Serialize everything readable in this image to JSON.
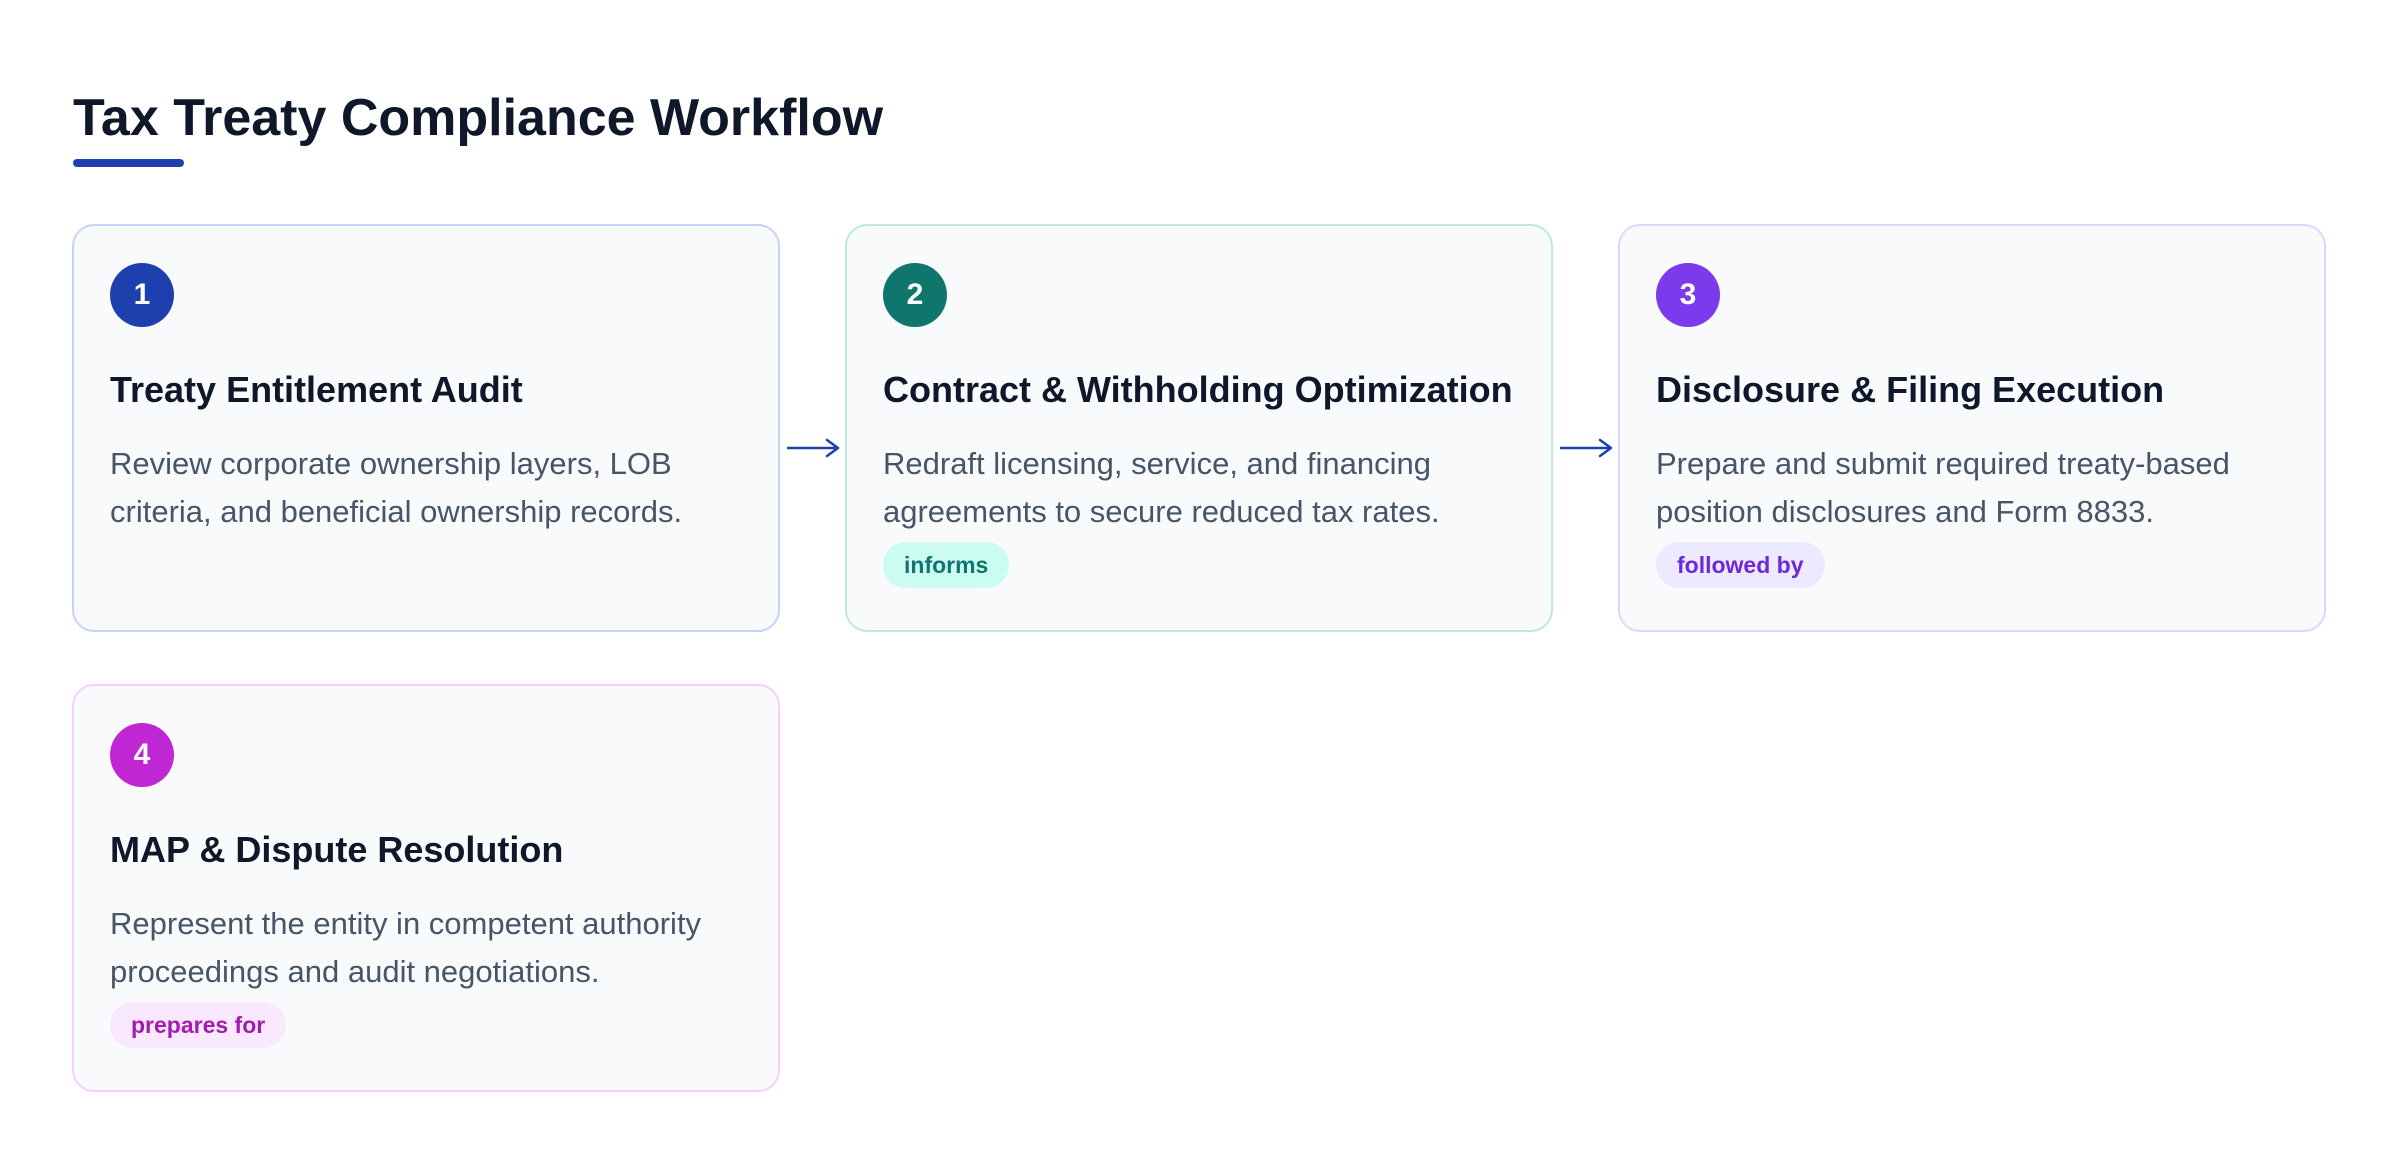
{
  "title": "Tax Treaty Compliance Workflow",
  "colors": {
    "accent": "#1e40af",
    "step1": "#1e40af",
    "step2": "#0f766e",
    "step3": "#7c3aed",
    "step4": "#c026d3"
  },
  "steps": [
    {
      "number": "1",
      "title": "Treaty Entitlement Audit",
      "description": "Review corporate ownership layers, LOB criteria, and beneficial ownership records.",
      "tag": ""
    },
    {
      "number": "2",
      "title": "Contract & Withholding Optimization",
      "description": "Redraft licensing, service, and financing agreements to secure reduced tax rates.",
      "tag": "informs"
    },
    {
      "number": "3",
      "title": "Disclosure & Filing Execution",
      "description": "Prepare and submit required treaty-based position disclosures and Form 8833.",
      "tag": "followed by"
    },
    {
      "number": "4",
      "title": "MAP & Dispute Resolution",
      "description": "Represent the entity in competent authority proceedings and audit negotiations.",
      "tag": "prepares for"
    }
  ],
  "connectors": [
    {
      "from": "1",
      "to": "2",
      "icon": "arrow-right-icon"
    },
    {
      "from": "2",
      "to": "3",
      "icon": "arrow-right-icon"
    }
  ]
}
